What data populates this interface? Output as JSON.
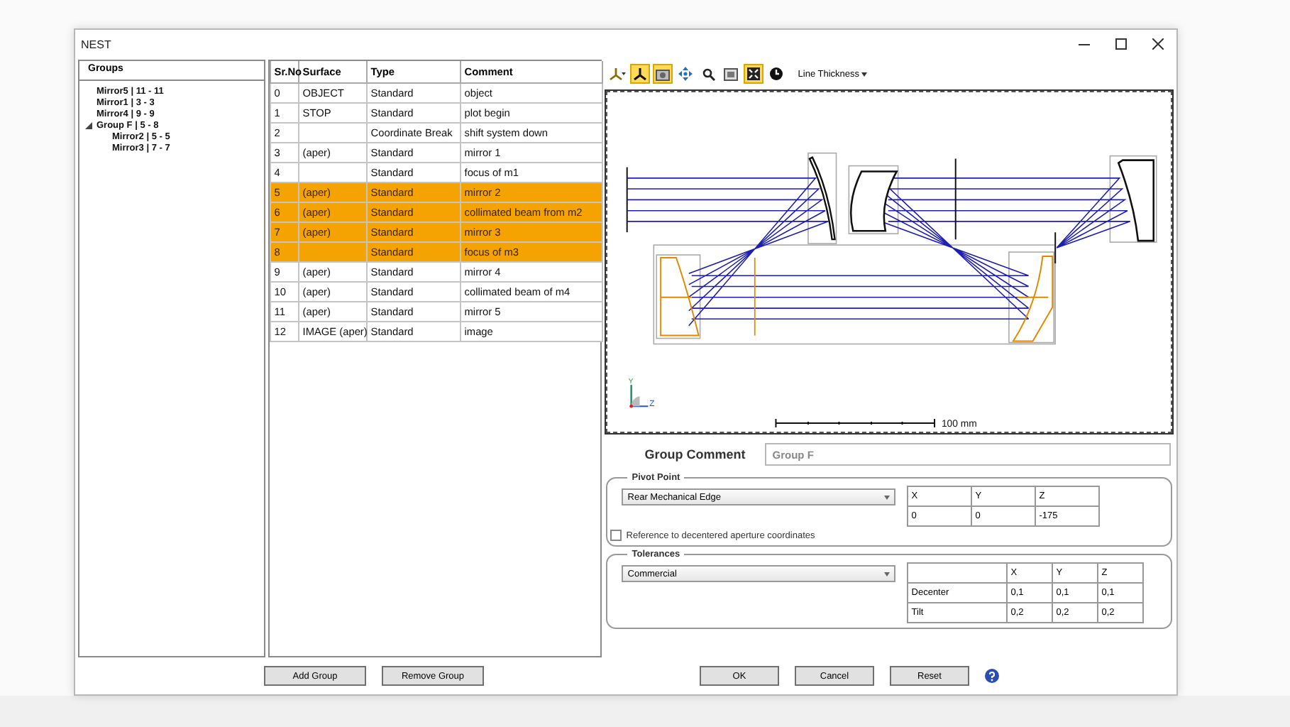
{
  "window": {
    "title": "NEST"
  },
  "groups": {
    "title": "Groups",
    "items": [
      {
        "label": "Mirror5 | 11 - 11"
      },
      {
        "label": "Mirror1 | 3 - 3"
      },
      {
        "label": "Mirror4 | 9 - 9"
      },
      {
        "label": "Group F | 5 - 8",
        "expanded": true,
        "children": [
          {
            "label": "Mirror2 | 5 - 5"
          },
          {
            "label": "Mirror3 | 7 - 7"
          }
        ]
      }
    ]
  },
  "table": {
    "columns": [
      "Sr.No",
      "Surface",
      "Type",
      "Comment"
    ],
    "rows": [
      {
        "cells": [
          "0",
          "OBJECT",
          "Standard",
          "object"
        ],
        "selected": false
      },
      {
        "cells": [
          "1",
          "STOP",
          "Standard",
          "plot begin"
        ],
        "selected": false
      },
      {
        "cells": [
          "2",
          "",
          "Coordinate Break",
          "shift system down"
        ],
        "selected": false
      },
      {
        "cells": [
          "3",
          "(aper)",
          "Standard",
          "mirror 1"
        ],
        "selected": false
      },
      {
        "cells": [
          "4",
          "",
          "Standard",
          "focus of m1"
        ],
        "selected": false
      },
      {
        "cells": [
          "5",
          "(aper)",
          "Standard",
          "mirror 2"
        ],
        "selected": true
      },
      {
        "cells": [
          "6",
          "(aper)",
          "Standard",
          "collimated beam from m2"
        ],
        "selected": true
      },
      {
        "cells": [
          "7",
          "(aper)",
          "Standard",
          "mirror 3"
        ],
        "selected": true
      },
      {
        "cells": [
          "8",
          "",
          "Standard",
          "focus of m3"
        ],
        "selected": true
      },
      {
        "cells": [
          "9",
          "(aper)",
          "Standard",
          "mirror 4"
        ],
        "selected": false
      },
      {
        "cells": [
          "10",
          "(aper)",
          "Standard",
          "collimated beam of m4"
        ],
        "selected": false
      },
      {
        "cells": [
          "11",
          "(aper)",
          "Standard",
          "mirror 5"
        ],
        "selected": false
      },
      {
        "cells": [
          "12",
          "IMAGE (aper)",
          "Standard",
          "image"
        ],
        "selected": false
      }
    ]
  },
  "toolbar": {
    "items": [
      {
        "kind": "view-menu",
        "selected": false
      },
      {
        "kind": "axes",
        "selected": true
      },
      {
        "kind": "camera",
        "selected": true
      },
      {
        "kind": "pan",
        "selected": false
      },
      {
        "kind": "zoom",
        "selected": false
      },
      {
        "kind": "snapshot",
        "selected": false
      },
      {
        "kind": "fit",
        "selected": true
      },
      {
        "kind": "reset",
        "selected": false
      }
    ],
    "line_thickness": "Line Thickness"
  },
  "view": {
    "axis_y": "Y",
    "axis_z": "Z",
    "scale": "100 mm"
  },
  "group_comment": {
    "label": "Group Comment",
    "value": "Group F"
  },
  "pivot": {
    "title": "Pivot Point",
    "dropdown": "Rear Mechanical Edge",
    "columns": [
      "X",
      "Y",
      "Z"
    ],
    "values": [
      "0",
      "0",
      "-175"
    ],
    "reference_checkbox": {
      "label": "Reference to decentered aperture coordinates",
      "checked": false
    }
  },
  "tolerances": {
    "title": "Tolerances",
    "dropdown": "Commercial",
    "columns": [
      "X",
      "Y",
      "Z"
    ],
    "rows": [
      {
        "label": "Decenter",
        "values": [
          "0,1",
          "0,1",
          "0,1"
        ]
      },
      {
        "label": "Tilt",
        "values": [
          "0,2",
          "0,2",
          "0,2"
        ]
      }
    ]
  },
  "left_buttons": [
    "Add Group",
    "Remove Group"
  ],
  "right_buttons": [
    "OK",
    "Cancel",
    "Reset"
  ]
}
